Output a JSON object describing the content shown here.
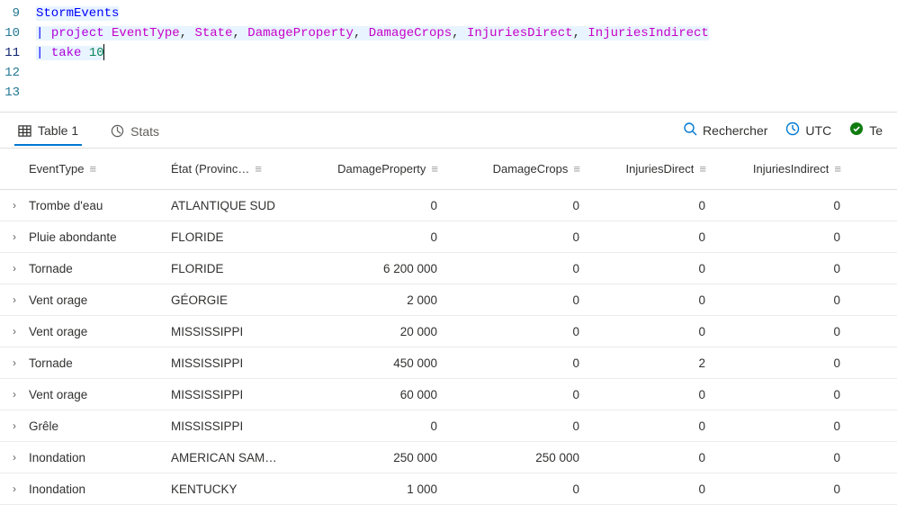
{
  "editor": {
    "lines": [
      {
        "num": "9",
        "tokens": [
          [
            "tk-table",
            "StormEvents"
          ]
        ],
        "hl": true
      },
      {
        "num": "10",
        "tokens": [
          [
            "tk-op",
            "| "
          ],
          [
            "tk-cmd",
            "project "
          ],
          [
            "tk-col",
            "EventType"
          ],
          [
            "tk-comma",
            ", "
          ],
          [
            "tk-col",
            "State"
          ],
          [
            "tk-comma",
            ", "
          ],
          [
            "tk-col",
            "DamageProperty"
          ],
          [
            "tk-comma",
            ", "
          ],
          [
            "tk-col",
            "DamageCrops"
          ],
          [
            "tk-comma",
            ", "
          ],
          [
            "tk-col",
            "InjuriesDirect"
          ],
          [
            "tk-comma",
            ", "
          ],
          [
            "tk-col",
            "InjuriesIndirect"
          ]
        ],
        "hl": true
      },
      {
        "num": "11",
        "tokens": [
          [
            "tk-op",
            "| "
          ],
          [
            "tk-cmd",
            "take "
          ],
          [
            "tk-num",
            "10"
          ]
        ],
        "hl": true,
        "cursor": true,
        "active": true
      },
      {
        "num": "12",
        "tokens": [],
        "hl": false
      },
      {
        "num": "13",
        "tokens": [],
        "hl": false
      }
    ]
  },
  "tabs": {
    "table": "Table 1",
    "stats": "Stats"
  },
  "toolbar": {
    "search": "Rechercher",
    "utc": "UTC",
    "status": "Te"
  },
  "grid": {
    "menu_glyph": "≡",
    "columns": [
      "EventType",
      "État (Provinc…",
      "DamageProperty",
      "DamageCrops",
      "InjuriesDirect",
      "InjuriesIndirect"
    ],
    "rows": [
      [
        "Trombe d'eau",
        "ATLANTIQUE SUD",
        "0",
        "0",
        "0",
        "0"
      ],
      [
        "Pluie abondante",
        "FLORIDE",
        "0",
        "0",
        "0",
        "0"
      ],
      [
        "Tornade",
        "FLORIDE",
        "6 200 000",
        "0",
        "0",
        "0"
      ],
      [
        "Vent orage",
        "GÉORGIE",
        "2 000",
        "0",
        "0",
        "0"
      ],
      [
        "Vent orage",
        "MISSISSIPPI",
        "20 000",
        "0",
        "0",
        "0"
      ],
      [
        "Tornade",
        "MISSISSIPPI",
        "450 000",
        "0",
        "2",
        "0"
      ],
      [
        "Vent orage",
        "MISSISSIPPI",
        "60 000",
        "0",
        "0",
        "0"
      ],
      [
        "Grêle",
        "MISSISSIPPI",
        "0",
        "0",
        "0",
        "0"
      ],
      [
        "Inondation",
        "AMERICAN SAM…",
        "250 000",
        "250 000",
        "0",
        "0"
      ],
      [
        "Inondation",
        "KENTUCKY",
        "1 000",
        "0",
        "0",
        "0"
      ]
    ]
  }
}
